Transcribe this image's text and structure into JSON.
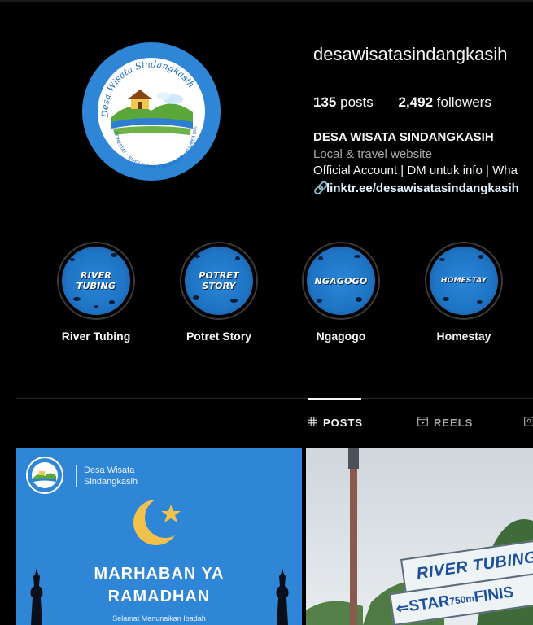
{
  "profile": {
    "username": "desawisatasindangkasih",
    "posts_count": "135",
    "posts_label": "posts",
    "followers_count": "2,492",
    "followers_label": "followers",
    "display_name": "DESA WISATA SINDANGKASIH",
    "category": "Local & travel website",
    "bio": "Official Account | DM untuk info | Wha",
    "link": "linktr.ee/desawisatasindangkasih",
    "avatar_arc_text": "Desa Wisata Sindangkasih",
    "avatar_footer_text": "HOMESTAY • RIVER TUBING • NGAGOGO • KULINER DLL"
  },
  "highlights": [
    {
      "cover_text": "RIVER TUBING",
      "label": "River Tubing"
    },
    {
      "cover_text": "POTRET STORY",
      "label": "Potret Story"
    },
    {
      "cover_text": "NGAGOGO",
      "label": "Ngagogo"
    },
    {
      "cover_text": "HOMESTAY",
      "label": "Homestay"
    }
  ],
  "tabs": [
    {
      "label": "POSTS",
      "icon": "grid-icon",
      "active": true
    },
    {
      "label": "REELS",
      "icon": "reels-icon",
      "active": false
    }
  ],
  "posts": [
    {
      "brand_line1": "Desa Wisata",
      "brand_line2": "Sindangkasih",
      "headline_line1": "MARHABAN YA",
      "headline_line2": "RAMADHAN",
      "subtext": "Selamat Menunaikan Ibadah"
    },
    {
      "sign_top": "RIVER TUBING",
      "sign_bottom_start": "STAR",
      "sign_bottom_distance": "750m",
      "sign_bottom_finish": "FINIS"
    }
  ],
  "colors": {
    "background": "#000000",
    "brand_blue": "#2f86d6",
    "text_primary": "#f5f5f5",
    "text_secondary": "#a8a8a8",
    "link": "#e0f1ff"
  }
}
